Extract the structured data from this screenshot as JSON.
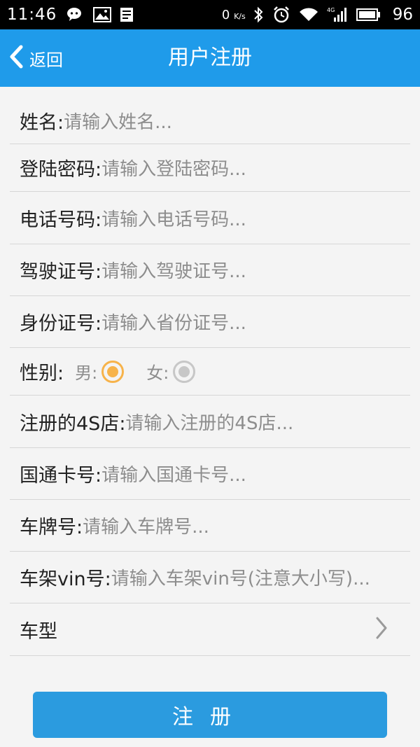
{
  "status_bar": {
    "time": "11:46",
    "net_speed": "0",
    "net_unit": "K/s",
    "battery": "96",
    "network_type": "4G",
    "icons": [
      "wechat-icon",
      "image-icon",
      "news-icon",
      "bluetooth-icon",
      "alarm-icon",
      "wifi-icon",
      "signal-icon",
      "battery-icon"
    ]
  },
  "header": {
    "back_label": "返回",
    "title": "用户注册"
  },
  "form": {
    "fields": [
      {
        "label": "姓名:",
        "placeholder": "请输入姓名..."
      },
      {
        "label": "登陆密码:",
        "placeholder": "请输入登陆密码..."
      },
      {
        "label": "电话号码:",
        "placeholder": "请输入电话号码..."
      },
      {
        "label": "驾驶证号:",
        "placeholder": "请输入驾驶证号..."
      },
      {
        "label": "身份证号:",
        "placeholder": "请输入省份证号..."
      },
      {
        "label": "注册的4S店:",
        "placeholder": "请输入注册的4S店..."
      },
      {
        "label": "国通卡号:",
        "placeholder": "请输入国通卡号..."
      },
      {
        "label": "车牌号:",
        "placeholder": "请输入车牌号..."
      },
      {
        "label": "车架vin号:",
        "placeholder": "请输入车架vin号(注意大小写)..."
      }
    ],
    "gender": {
      "label": "性别:",
      "male_label": "男:",
      "female_label": "女:",
      "selected": "男"
    },
    "car_model": {
      "label": "车型"
    }
  },
  "submit_label": "注册",
  "colors": {
    "accent": "#1f9bea",
    "button": "#2b9bdf",
    "radio_selected": "#f7b34a",
    "radio_unselected": "#c7c7c7"
  }
}
